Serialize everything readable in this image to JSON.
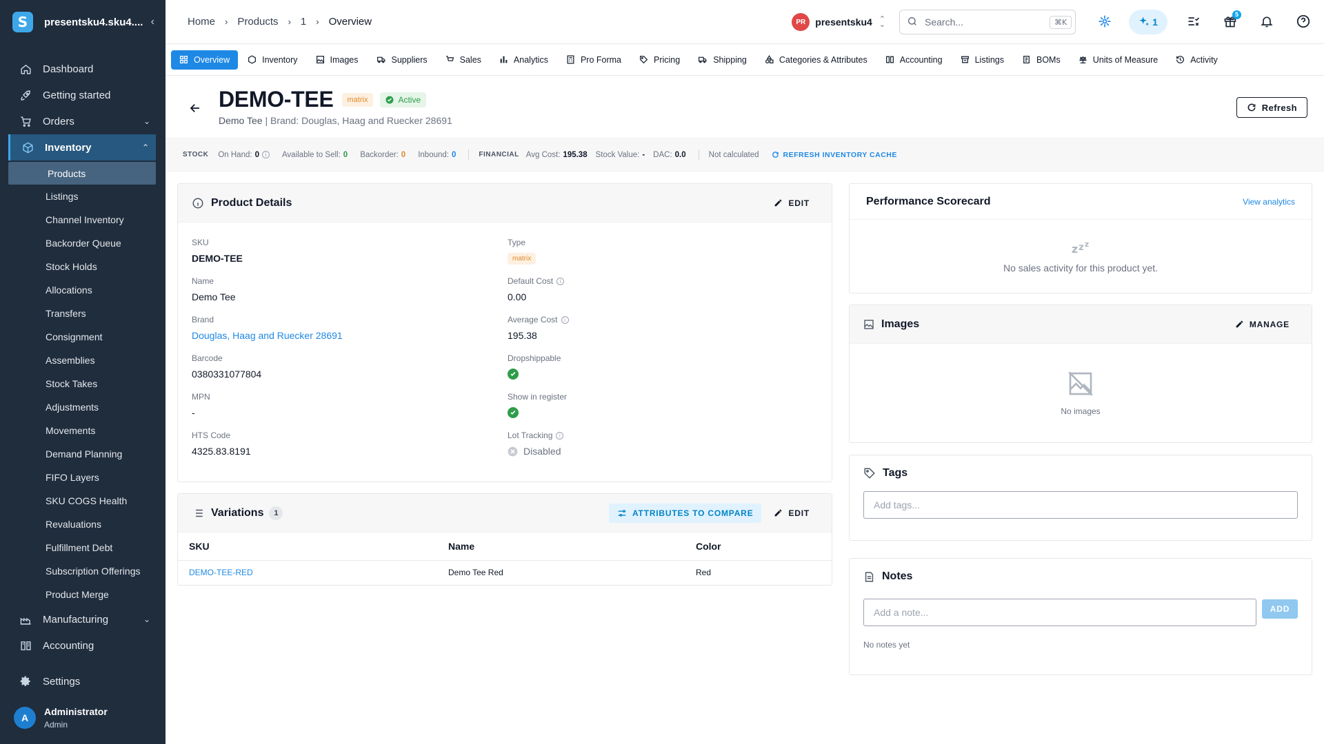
{
  "sidebar": {
    "org_name": "presentsku4.sku4....",
    "logo_letter": "S",
    "nav": [
      {
        "label": "Dashboard",
        "icon": "home-icon"
      },
      {
        "label": "Getting started",
        "icon": "rocket-icon"
      },
      {
        "label": "Orders",
        "icon": "cart-icon",
        "expandable": true
      },
      {
        "label": "Inventory",
        "icon": "cube-icon",
        "expandable": true,
        "expanded": true
      }
    ],
    "inventory_sub": [
      "Products",
      "Listings",
      "Channel Inventory",
      "Backorder Queue",
      "Stock Holds",
      "Allocations",
      "Transfers",
      "Consignment",
      "Assemblies",
      "Stock Takes",
      "Adjustments",
      "Movements",
      "Demand Planning",
      "FIFO Layers",
      "SKU COGS Health",
      "Revaluations",
      "Fulfillment Debt",
      "Subscription Offerings",
      "Product Merge"
    ],
    "manufacturing": "Manufacturing",
    "accounting": "Accounting",
    "settings": "Settings",
    "user": {
      "initial": "A",
      "name": "Administrator",
      "role": "Admin"
    }
  },
  "topbar": {
    "breadcrumb": [
      "Home",
      "Products",
      "1",
      "Overview"
    ],
    "account": {
      "initials": "PR",
      "name": "presentsku4"
    },
    "search": {
      "placeholder": "Search...",
      "shortcut": "⌘K"
    },
    "ai_count": "1",
    "gift_badge": "5"
  },
  "tabs": [
    "Overview",
    "Inventory",
    "Images",
    "Suppliers",
    "Sales",
    "Analytics",
    "Pro Forma",
    "Pricing",
    "Shipping",
    "Categories & Attributes",
    "Accounting",
    "Listings",
    "BOMs",
    "Units of Measure",
    "Activity"
  ],
  "product": {
    "sku": "DEMO-TEE",
    "type_badge": "matrix",
    "status": "Active",
    "name": "Demo Tee",
    "brand_line": "| Brand: Douglas, Haag and Ruecker 28691",
    "refresh_label": "Refresh"
  },
  "stats": {
    "stock_label": "STOCK",
    "on_hand_label": "On Hand:",
    "on_hand": "0",
    "available_label": "Available to Sell:",
    "available": "0",
    "backorder_label": "Backorder:",
    "backorder": "0",
    "inbound_label": "Inbound:",
    "inbound": "0",
    "financial_label": "FINANCIAL",
    "avg_cost_label": "Avg Cost:",
    "avg_cost": "195.38",
    "stock_value_label": "Stock Value:",
    "stock_value": "-",
    "dac_label": "DAC:",
    "dac": "0.0",
    "not_calculated": "Not calculated",
    "refresh_cache": "REFRESH INVENTORY CACHE"
  },
  "details": {
    "title": "Product Details",
    "edit": "EDIT",
    "sku_label": "SKU",
    "sku": "DEMO-TEE",
    "name_label": "Name",
    "name": "Demo Tee",
    "brand_label": "Brand",
    "brand": "Douglas, Haag and Ruecker 28691",
    "barcode_label": "Barcode",
    "barcode": "0380331077804",
    "mpn_label": "MPN",
    "mpn": "-",
    "hts_label": "HTS Code",
    "hts": "4325.83.8191",
    "type_label": "Type",
    "type": "matrix",
    "default_cost_label": "Default Cost",
    "default_cost": "0.00",
    "avg_cost_label": "Average Cost",
    "avg_cost": "195.38",
    "dropship_label": "Dropshippable",
    "register_label": "Show in register",
    "lot_label": "Lot Tracking",
    "lot": "Disabled"
  },
  "variations": {
    "title": "Variations",
    "count": "1",
    "compare": "ATTRIBUTES TO COMPARE",
    "edit": "EDIT",
    "columns": [
      "SKU",
      "Name",
      "Color"
    ],
    "rows": [
      [
        "DEMO-TEE-RED",
        "Demo Tee Red",
        "Red"
      ]
    ]
  },
  "scorecard": {
    "title": "Performance Scorecard",
    "link": "View analytics",
    "empty": "No sales activity for this product yet."
  },
  "images": {
    "title": "Images",
    "manage": "MANAGE",
    "empty": "No images"
  },
  "tags": {
    "title": "Tags",
    "placeholder": "Add tags..."
  },
  "notes": {
    "title": "Notes",
    "placeholder": "Add a note...",
    "add": "ADD",
    "empty": "No notes yet"
  }
}
